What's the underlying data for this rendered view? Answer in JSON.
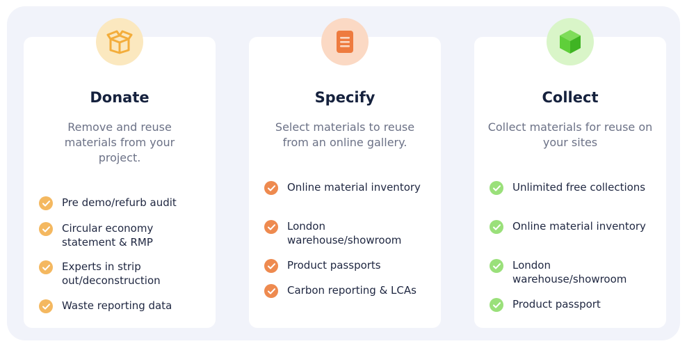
{
  "colors": {
    "donate_check": "#f4b860",
    "specify_check": "#ee8a4f",
    "collect_check": "#9ae07a",
    "donate_icon": "#f3ad3b",
    "specify_icon": "#ee7b3f",
    "collect_icon": "#5fcf3a"
  },
  "cards": [
    {
      "icon": "box-icon",
      "title": "Donate",
      "description": "Remove and reuse materials from your project.",
      "items": [
        "Pre demo/refurb audit",
        "Circular economy statement & RMP",
        "Experts in strip out/deconstruction",
        "Waste reporting data"
      ]
    },
    {
      "icon": "document-icon",
      "title": "Specify",
      "description": "Select materials to reuse from an online gallery.",
      "items": [
        "Online material inventory",
        "London warehouse/showroom",
        "Product passports",
        "Carbon reporting & LCAs"
      ]
    },
    {
      "icon": "cube-icon",
      "title": "Collect",
      "description": "Collect materials for reuse on your sites",
      "items": [
        "Unlimited free collections",
        "Online material inventory",
        "London warehouse/showroom",
        "Product passport"
      ]
    }
  ]
}
